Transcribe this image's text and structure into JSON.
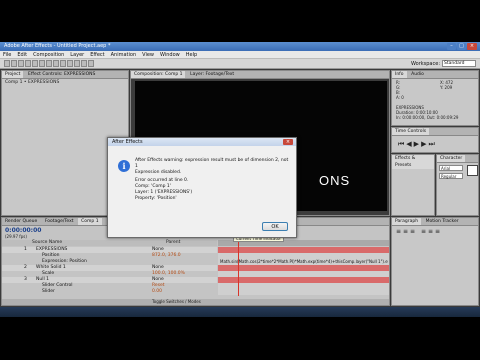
{
  "app": {
    "title": "Adobe After Effects - Untitled Project.aep *",
    "workspace_label": "Workspace:",
    "workspace_value": "Standard"
  },
  "menu": [
    "File",
    "Edit",
    "Composition",
    "Layer",
    "Effect",
    "Animation",
    "View",
    "Window",
    "Help"
  ],
  "project_panel": {
    "tabs": [
      "Project",
      "Effect Controls: EXPRESSIONS"
    ],
    "breadcrumb": "Comp 1 • EXPRESSIONS"
  },
  "comp_panel": {
    "tabs": [
      "Composition: Comp 1",
      "Layer: Footage/Text"
    ],
    "canvas_text": "ONS"
  },
  "right_panels": {
    "info_tab": "Info",
    "audio_tab": "Audio",
    "info_values": [
      "R:",
      "G:",
      "B:",
      "A: 0",
      "X: 472",
      "Y: 209"
    ],
    "info_text": [
      "EXPRESSIONS",
      "Duration: 0:00:10:00",
      "In: 0:00:00:00, Out: 0:00:09:29"
    ],
    "preview_tab": "Time Controls",
    "effects_tab": "Effects & Presets",
    "character_tab": "Character",
    "font": "Arial",
    "style": "Regular",
    "paragraph_tab": "Paragraph",
    "tracker_tab": "Motion Tracker"
  },
  "timeline": {
    "tabs": [
      "Render Queue",
      "Footage/Text",
      "Comp 1"
    ],
    "timecode": "0:00:00:00",
    "fps": "(29.97 fps)",
    "columns": [
      "Source Name",
      "Parent"
    ],
    "layers": [
      {
        "num": "1",
        "name": "EXPRESSIONS",
        "parent": "None"
      },
      {
        "num": "",
        "name": "Position",
        "parent": "872.0, 376.0"
      },
      {
        "num": "",
        "name": "Expression: Position",
        "parent": ""
      },
      {
        "num": "2",
        "name": "White Solid 1",
        "parent": "None"
      },
      {
        "num": "",
        "name": "Scale",
        "parent": "100.0, 100.0%"
      },
      {
        "num": "3",
        "name": "Null 1",
        "parent": "None"
      },
      {
        "num": "",
        "name": "Slider Control",
        "parent": "Reset"
      },
      {
        "num": "",
        "name": "Slider",
        "parent": "0.00"
      }
    ],
    "expression_text": "Math.sin(Math.cos(2*time*2*Math.PI)*Math.exp(time*4)+thisComp.layer(\"Null 1\").effect(\"Slider Control\")(\"Slider\")",
    "tooltip": "Current Time Indicator",
    "footer": "Toggle Switches / Modes"
  },
  "dialog": {
    "title": "After Effects",
    "message_line1": "After Effects warning: expression result must be of dimension 2, not 1",
    "message_line2": "Expression disabled.",
    "error_lines": [
      "Error occurred at line 0.",
      "Comp: 'Comp 1'",
      "Layer: 1 ('EXPRESSIONS')",
      "Property: 'Position'"
    ],
    "ok_label": "OK"
  },
  "colors": {
    "dialog_bg": "#f0f0f0",
    "titlebar": "#3a6cb5",
    "layer_bar": "#d96a6a",
    "playhead": "#d8342a"
  }
}
